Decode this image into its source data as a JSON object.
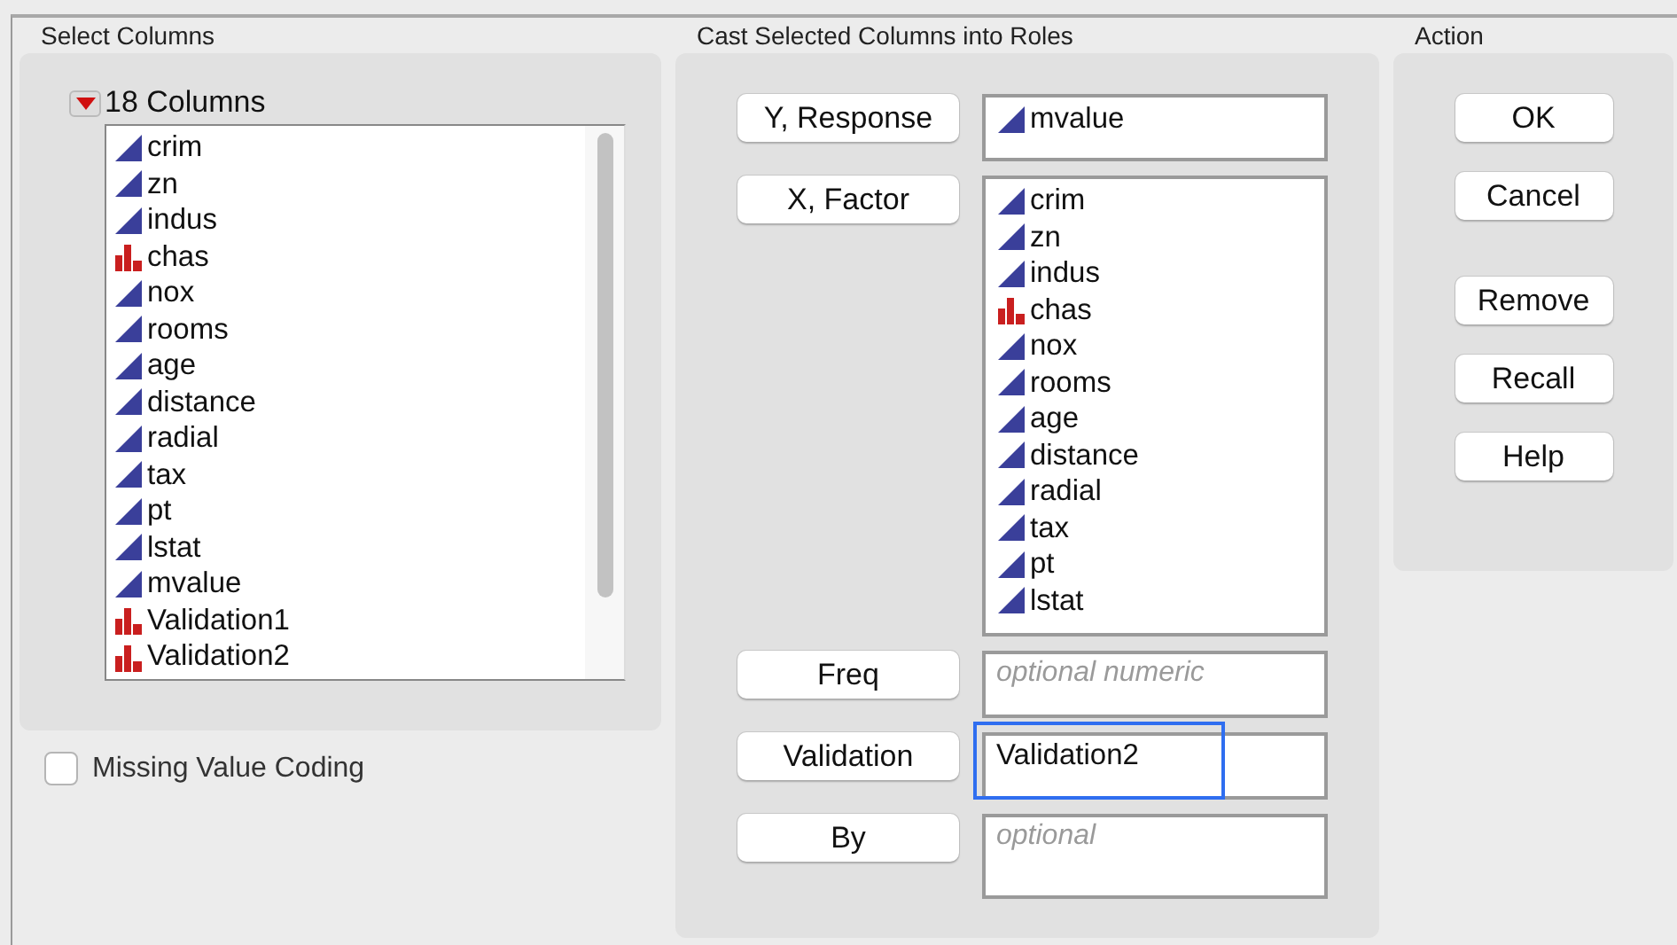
{
  "select_columns": {
    "title": "Select Columns",
    "count_label": "18 Columns",
    "expanded": true,
    "columns": [
      {
        "name": "crim",
        "kind": "continuous"
      },
      {
        "name": "zn",
        "kind": "continuous"
      },
      {
        "name": "indus",
        "kind": "continuous"
      },
      {
        "name": "chas",
        "kind": "nominal"
      },
      {
        "name": "nox",
        "kind": "continuous"
      },
      {
        "name": "rooms",
        "kind": "continuous"
      },
      {
        "name": "age",
        "kind": "continuous"
      },
      {
        "name": "distance",
        "kind": "continuous"
      },
      {
        "name": "radial",
        "kind": "continuous"
      },
      {
        "name": "tax",
        "kind": "continuous"
      },
      {
        "name": "pt",
        "kind": "continuous"
      },
      {
        "name": "lstat",
        "kind": "continuous"
      },
      {
        "name": "mvalue",
        "kind": "continuous"
      },
      {
        "name": "Validation1",
        "kind": "nominal"
      },
      {
        "name": "Validation2",
        "kind": "nominal"
      }
    ]
  },
  "missing_value_coding": {
    "label": "Missing Value Coding",
    "checked": false
  },
  "roles": {
    "title": "Cast Selected Columns into Roles",
    "rows": [
      {
        "button": "Y, Response",
        "focused": false,
        "items": [
          {
            "name": "mvalue",
            "kind": "continuous"
          }
        ]
      },
      {
        "button": "X, Factor",
        "focused": false,
        "items": [
          {
            "name": "crim",
            "kind": "continuous"
          },
          {
            "name": "zn",
            "kind": "continuous"
          },
          {
            "name": "indus",
            "kind": "continuous"
          },
          {
            "name": "chas",
            "kind": "nominal"
          },
          {
            "name": "nox",
            "kind": "continuous"
          },
          {
            "name": "rooms",
            "kind": "continuous"
          },
          {
            "name": "age",
            "kind": "continuous"
          },
          {
            "name": "distance",
            "kind": "continuous"
          },
          {
            "name": "radial",
            "kind": "continuous"
          },
          {
            "name": "tax",
            "kind": "continuous"
          },
          {
            "name": "pt",
            "kind": "continuous"
          },
          {
            "name": "lstat",
            "kind": "continuous"
          }
        ]
      },
      {
        "button": "Freq",
        "focused": false,
        "placeholder": "optional numeric"
      },
      {
        "button": "Validation",
        "focused": true,
        "value": "Validation2"
      },
      {
        "button": "By",
        "focused": false,
        "placeholder": "optional"
      }
    ]
  },
  "action": {
    "title": "Action",
    "groups": [
      [
        "OK",
        "Cancel"
      ],
      [
        "Remove",
        "Recall",
        "Help"
      ]
    ]
  }
}
